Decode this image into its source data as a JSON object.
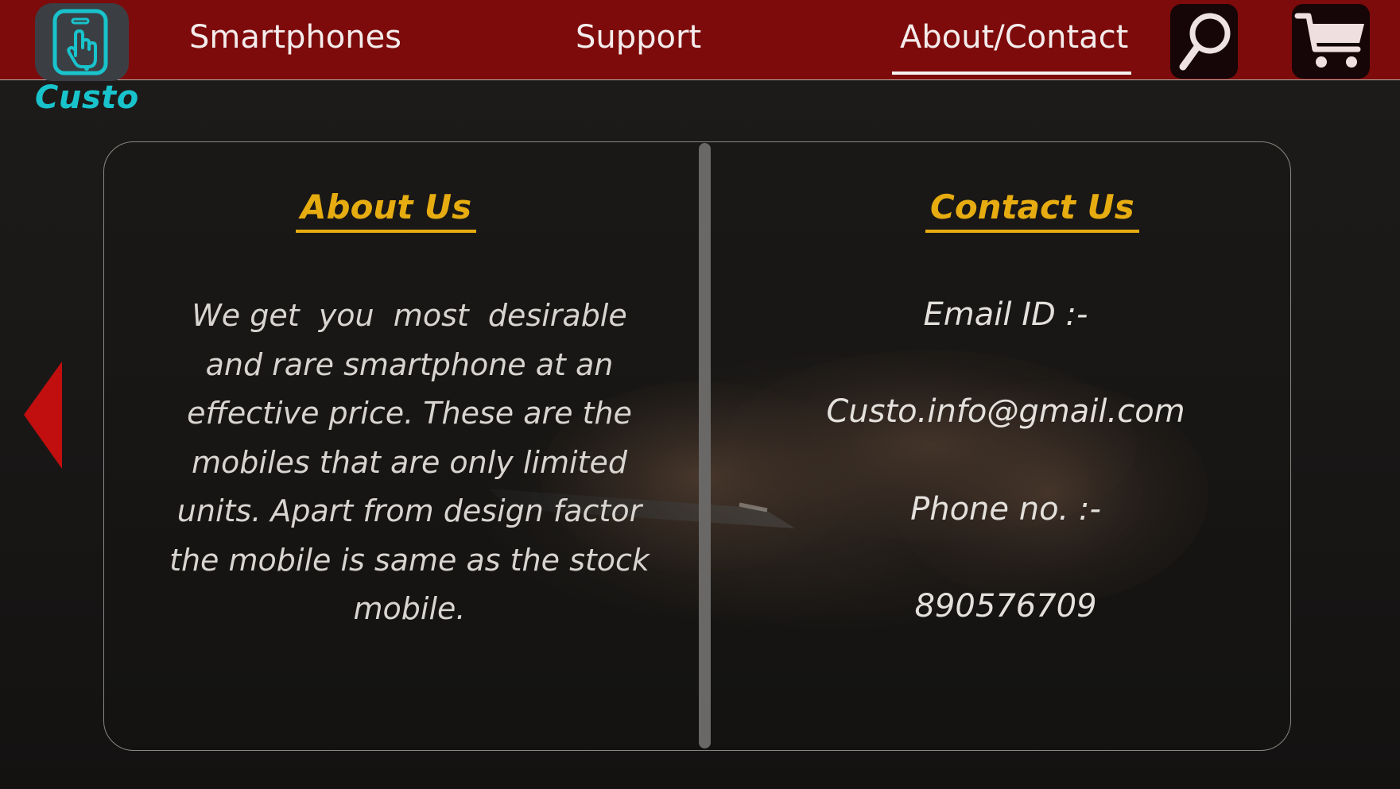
{
  "brand": {
    "name": "Custo",
    "logo_icon": "phone-tap-icon",
    "accent_color": "#19c3cc"
  },
  "nav": {
    "items": [
      {
        "label": "Smartphones",
        "active": false
      },
      {
        "label": "Support",
        "active": false
      },
      {
        "label": "About/Contact",
        "active": true
      }
    ],
    "search_icon": "search-icon",
    "cart_icon": "cart-icon",
    "bar_color": "#7e0b0b"
  },
  "about": {
    "heading": "About Us",
    "body": "We get  you  most  desirable\nand rare smartphone at an\neffective price. These are the\nmobiles that are only limited\nunits. Apart from design factor\nthe mobile is same as the stock\nmobile."
  },
  "contact": {
    "heading": "Contact Us",
    "email_label": "Email ID :-",
    "email_value": "Custo.info@gmail.com",
    "phone_label": "Phone no. :-",
    "phone_value": "890576709"
  },
  "colors": {
    "heading": "#e6ac10",
    "arrow": "#c10f0f"
  },
  "navigation_arrow_icon": "left-triangle-icon"
}
